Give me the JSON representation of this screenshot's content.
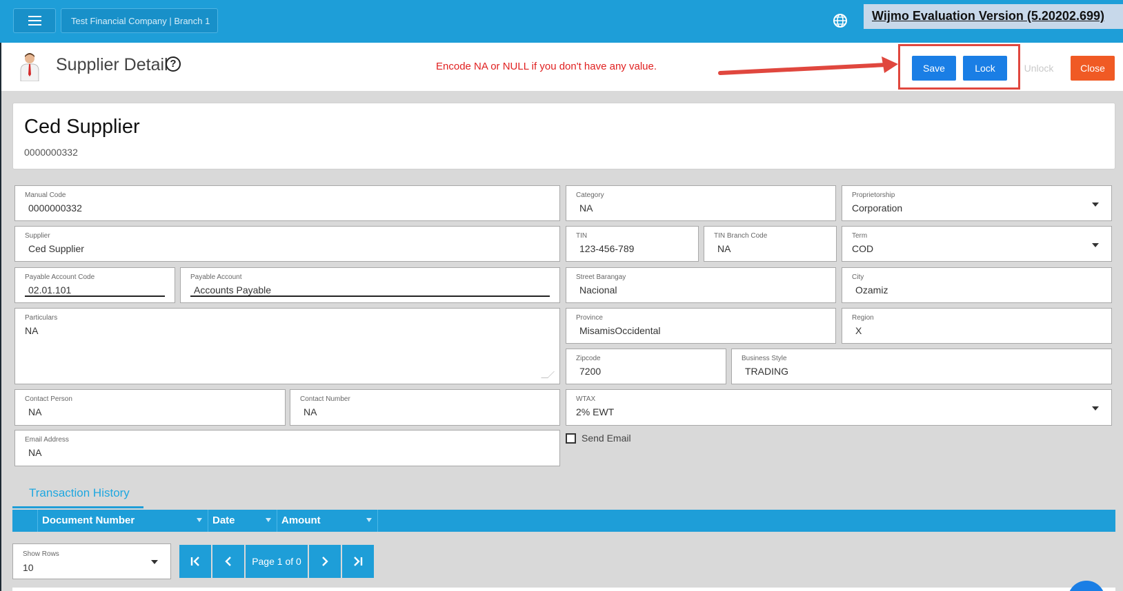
{
  "topbar": {
    "company": "Test Financial Company | Branch 1",
    "watermark": "Wijmo Evaluation Version (5.20202.699)"
  },
  "header": {
    "title": "Supplier Detail",
    "help": "?",
    "notice": "Encode NA or NULL if you don't have any value.",
    "buttons": {
      "save": "Save",
      "lock": "Lock",
      "unlock": "Unlock",
      "close": "Close"
    }
  },
  "summary": {
    "name": "Ced Supplier",
    "code": "0000000332"
  },
  "fields": {
    "manual_code": {
      "label": "Manual Code",
      "value": "0000000332"
    },
    "category": {
      "label": "Category",
      "value": "NA"
    },
    "proprietorship": {
      "label": "Proprietorship",
      "value": "Corporation"
    },
    "supplier": {
      "label": "Supplier",
      "value": "Ced Supplier"
    },
    "tin": {
      "label": "TIN",
      "value": "123-456-789"
    },
    "tin_branch": {
      "label": "TIN Branch Code",
      "value": "NA"
    },
    "term": {
      "label": "Term",
      "value": "COD"
    },
    "payable_code": {
      "label": "Payable Account Code",
      "value": "02.01.101"
    },
    "payable_account": {
      "label": "Payable Account",
      "value": "Accounts Payable"
    },
    "street": {
      "label": "Street Barangay",
      "value": "Nacional"
    },
    "city": {
      "label": "City",
      "value": "Ozamiz"
    },
    "particulars": {
      "label": "Particulars",
      "value": "NA"
    },
    "province": {
      "label": "Province",
      "value": "MisamisOccidental"
    },
    "region": {
      "label": "Region",
      "value": "X"
    },
    "zipcode": {
      "label": "Zipcode",
      "value": "7200"
    },
    "business_style": {
      "label": "Business Style",
      "value": "TRADING"
    },
    "contact_person": {
      "label": "Contact Person",
      "value": "NA"
    },
    "contact_number": {
      "label": "Contact Number",
      "value": "NA"
    },
    "wtax": {
      "label": "WTAX",
      "value": "2% EWT"
    },
    "email": {
      "label": "Email Address",
      "value": "NA"
    }
  },
  "send_email": {
    "label": "Send Email",
    "checked": false
  },
  "tabs": [
    {
      "label": "Transaction History",
      "active": true
    }
  ],
  "grid": {
    "columns": [
      "Document Number",
      "Date",
      "Amount"
    ]
  },
  "pager": {
    "rows_label": "Show Rows",
    "rows_value": "10",
    "page_text": "Page 1 of 0"
  },
  "colors": {
    "primary": "#1e9ed8",
    "button_blue": "#1a7ee5",
    "close": "#f05a24",
    "notice": "#e02020",
    "highlight": "#e0473e"
  }
}
